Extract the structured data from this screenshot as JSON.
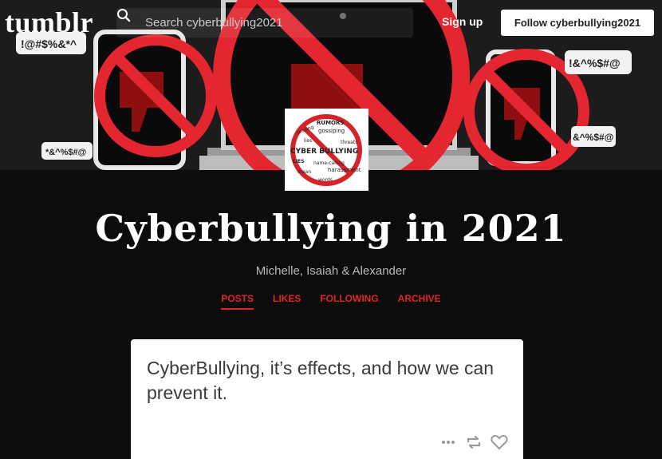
{
  "header": {
    "logo": "tumblr",
    "search": {
      "placeholder": "Search cyberbullying2021"
    },
    "signup_label": "Sign up",
    "follow_label": "Follow cyberbullying2021",
    "banner_texts": [
      "!@#$%&*^",
      "*&^%$#@",
      "!&^%$#@",
      "&^%$#@"
    ],
    "avatar_words": [
      "RUMORS",
      "teasing",
      "gossiping",
      "lies",
      "threats",
      "CYBER BULLYING",
      "LIES",
      "name-calling",
      "harassment",
      "mean",
      "words"
    ]
  },
  "blog": {
    "title": "Cyberbullying in 2021",
    "subtitle": "Michelle, Isaiah & Alexander"
  },
  "nav": {
    "items": [
      {
        "label": "POSTS",
        "active": true
      },
      {
        "label": "LIKES",
        "active": false
      },
      {
        "label": "FOLLOWING",
        "active": false
      },
      {
        "label": "ARCHIVE",
        "active": false
      }
    ]
  },
  "post": {
    "text": "CyberBullying, it’s effects, and how we can prevent it.",
    "actions": [
      "more-icon",
      "reblog-icon",
      "heart-icon"
    ]
  },
  "colors": {
    "accent": "#e1261c",
    "background": "#0c0c0c",
    "card": "#ffffff"
  }
}
